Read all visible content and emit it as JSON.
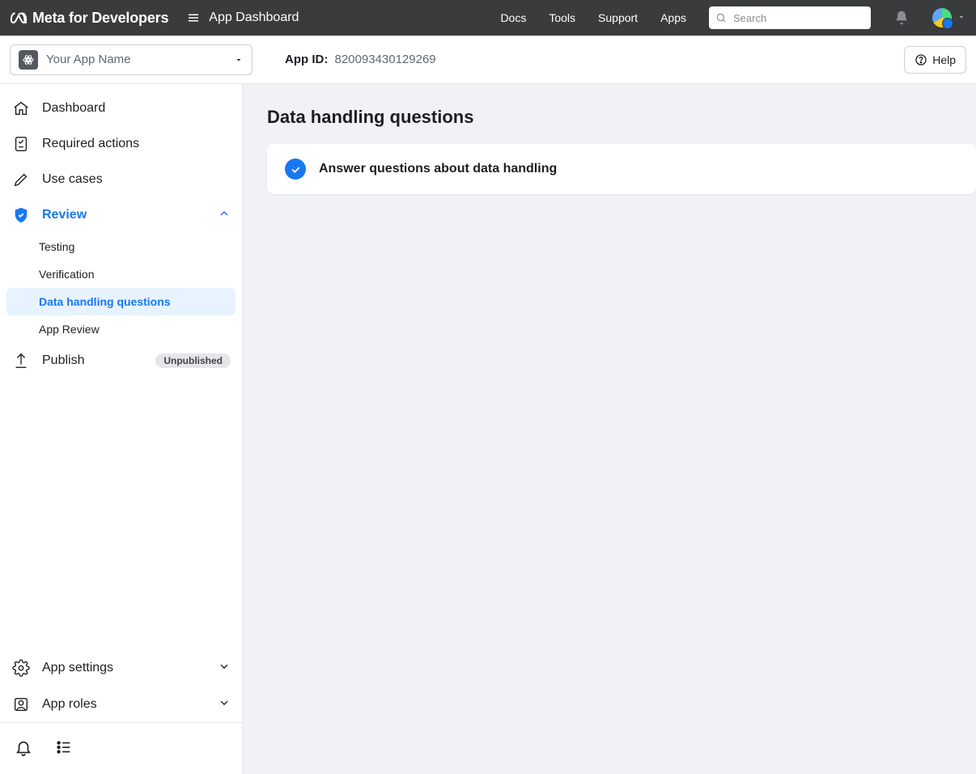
{
  "header": {
    "brand": "Meta for Developers",
    "dashboard_label": "App Dashboard",
    "nav": {
      "docs": "Docs",
      "tools": "Tools",
      "support": "Support",
      "apps": "Apps"
    },
    "search_placeholder": "Search"
  },
  "app_bar": {
    "app_name": "Your App Name",
    "app_id_label": "App ID:",
    "app_id_value": "820093430129269",
    "help_label": "Help"
  },
  "sidebar": {
    "dashboard": "Dashboard",
    "required_actions": "Required actions",
    "use_cases": "Use cases",
    "review": "Review",
    "review_children": {
      "testing": "Testing",
      "verification": "Verification",
      "data_handling_questions": "Data handling questions",
      "app_review": "App Review"
    },
    "publish": "Publish",
    "publish_badge": "Unpublished",
    "app_settings": "App settings",
    "app_roles": "App roles"
  },
  "main": {
    "page_title": "Data handling questions",
    "card_title": "Answer questions about data handling"
  }
}
